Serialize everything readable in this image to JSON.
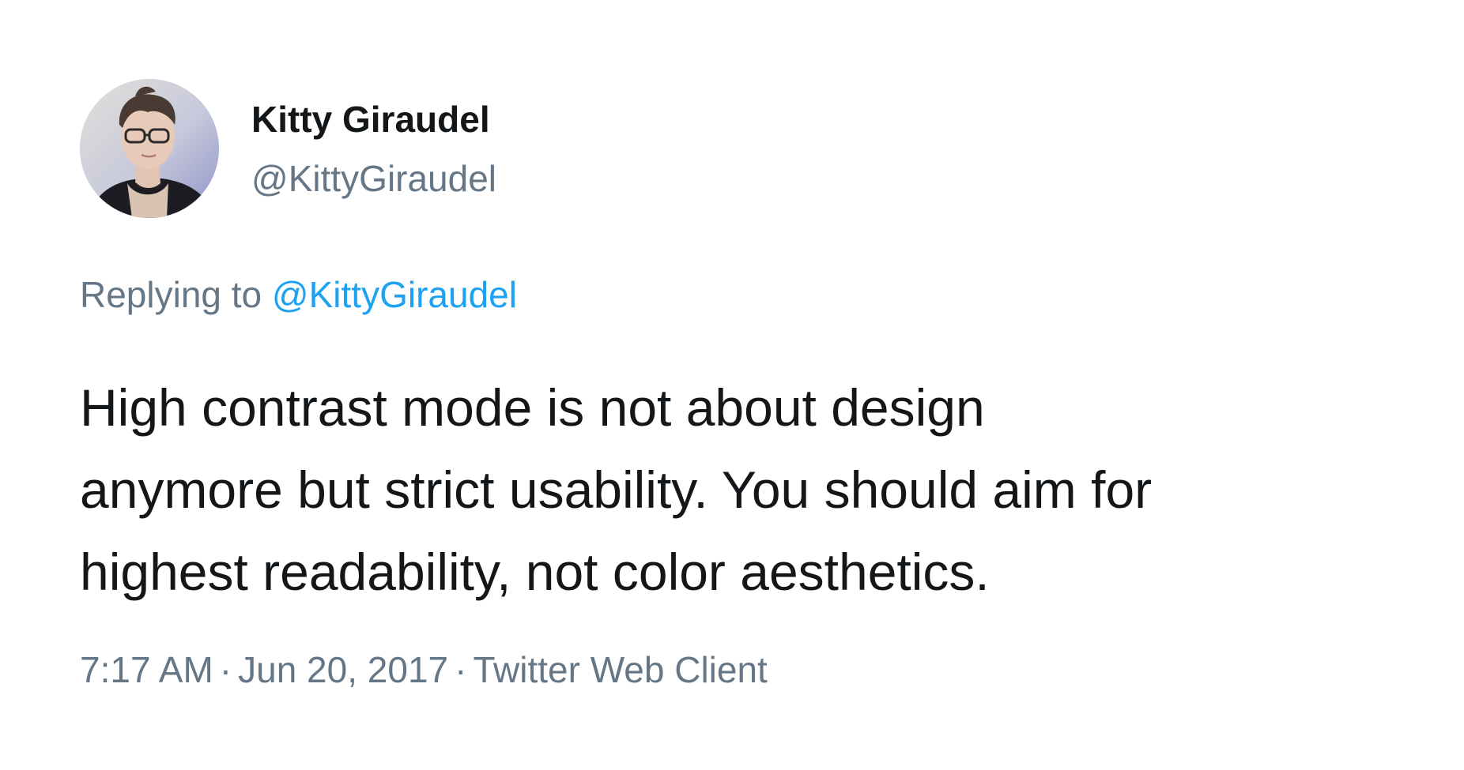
{
  "author": {
    "display_name": "Kitty Giraudel",
    "handle": "@KittyGiraudel"
  },
  "reply": {
    "prefix": "Replying to",
    "mention": "@KittyGiraudel"
  },
  "tweet": {
    "lines": [
      "High contrast mode is not about design",
      "anymore but strict usability. You should aim for",
      "highest readability, not color aesthetics."
    ]
  },
  "meta": {
    "time": "7:17 AM",
    "separator": "·",
    "date": "Jun 20, 2017",
    "source": "Twitter Web Client"
  },
  "colors": {
    "text_primary": "#14171a",
    "text_secondary": "#657786",
    "link": "#1da1f2",
    "background": "#ffffff"
  }
}
